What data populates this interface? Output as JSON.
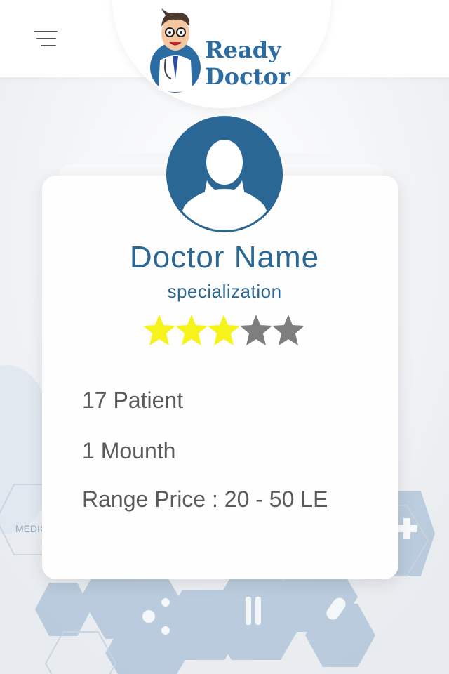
{
  "header": {
    "menu_icon": "hamburger-menu-icon",
    "logo_icon": "doctor-mascot-icon",
    "logo_line1": "Ready",
    "logo_line2": "Doctor"
  },
  "profile": {
    "avatar_icon": "user-avatar-icon",
    "name": "Doctor Name",
    "specialization": "specialization",
    "rating": 3,
    "rating_max": 5,
    "star_filled_color": "#f6f21c",
    "star_empty_color": "#7e7e7e"
  },
  "details": {
    "patients": "17 Patient",
    "duration": "1 Mounth",
    "price_range": "Range Price : 20 - 50 LE"
  },
  "colors": {
    "brand": "#2b6794",
    "text": "#5a5a5a"
  }
}
